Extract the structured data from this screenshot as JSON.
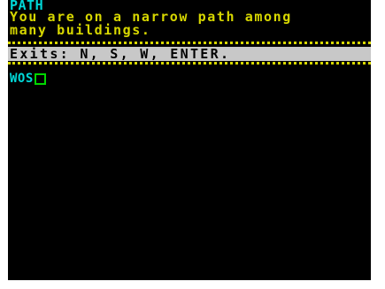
{
  "game": {
    "location_title": "PATH",
    "description": "You are on a narrow path among\nmany buildings.",
    "exits_text": "Exits: N, S, W, ENTER.",
    "command_input": "WOS"
  },
  "colors": {
    "screen_background": "#000000",
    "border": "#ffffff",
    "title": "#00d7d7",
    "description": "#d7d700",
    "divider": "#d7d700",
    "exits_bar_background": "#c8c8c8",
    "exits_text": "#000000",
    "input": "#00d7d7",
    "cursor": "#00d700"
  }
}
